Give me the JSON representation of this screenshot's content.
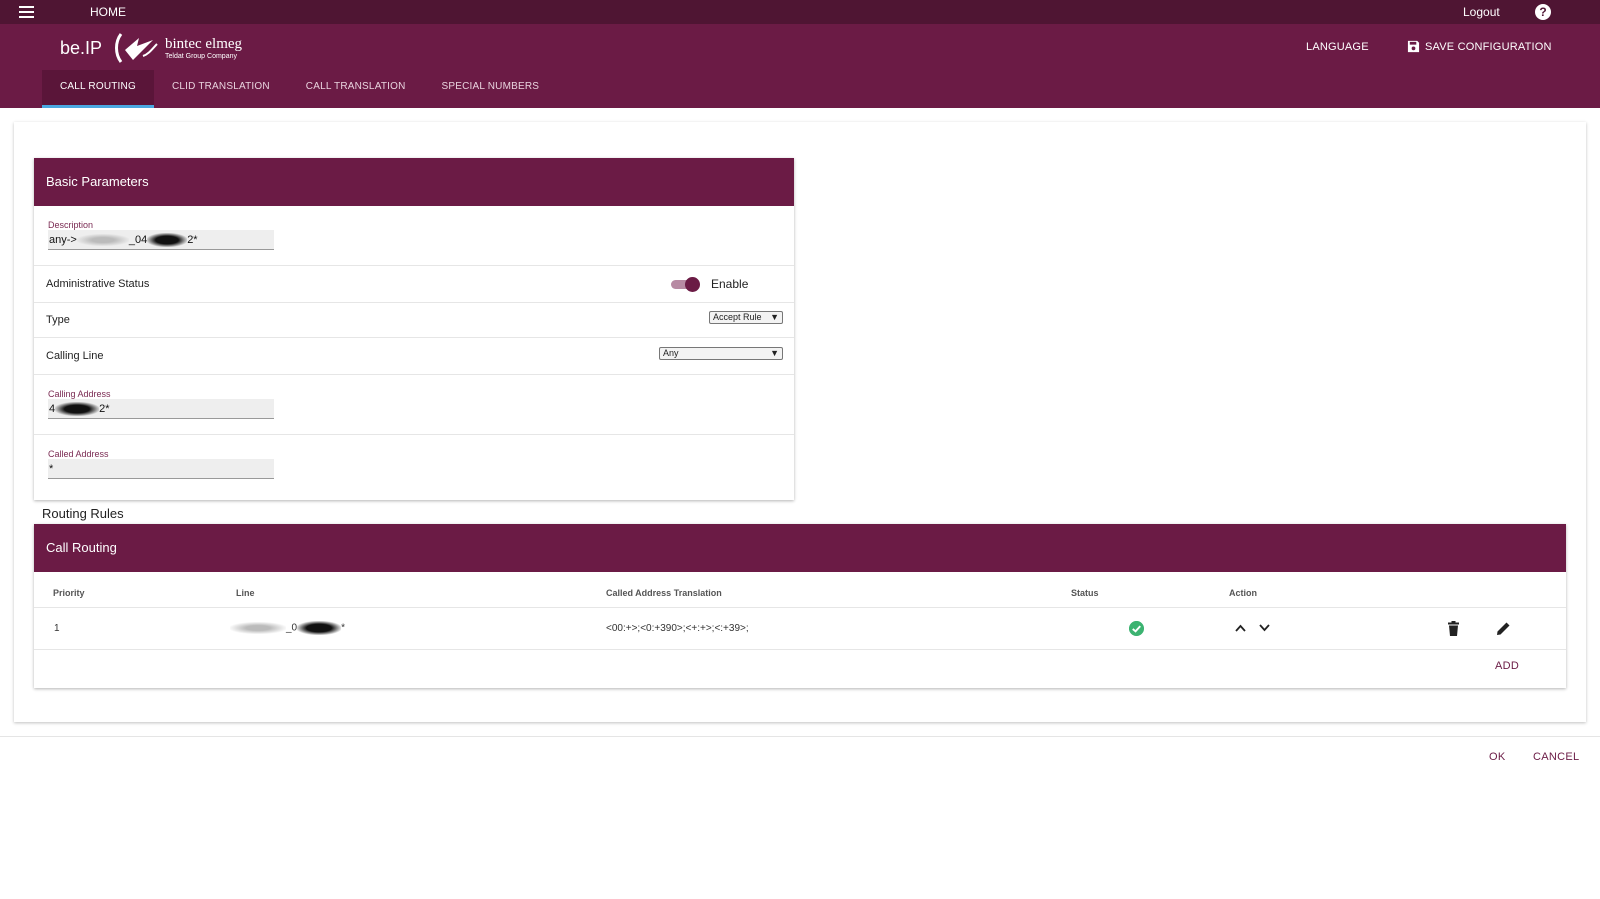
{
  "topbar": {
    "home_label": "HOME",
    "logout_label": "Logout",
    "help_glyph": "?"
  },
  "header": {
    "app_title": "be.IP",
    "brand_name": "bintec elmeg",
    "brand_tagline": "Teldat Group Company",
    "language_label": "LANGUAGE",
    "save_label": "SAVE CONFIGURATION"
  },
  "tabs": [
    {
      "label": "CALL ROUTING",
      "active": true
    },
    {
      "label": "CLID TRANSLATION",
      "active": false
    },
    {
      "label": "CALL TRANSLATION",
      "active": false
    },
    {
      "label": "SPECIAL NUMBERS",
      "active": false
    }
  ],
  "basic": {
    "title": "Basic Parameters",
    "description": {
      "label": "Description",
      "value_prefix": "any->",
      "value_mid": "_04",
      "value_suffix": "2*"
    },
    "admin_status": {
      "label": "Administrative Status",
      "toggle_label": "Enable",
      "enabled": true
    },
    "type": {
      "label": "Type",
      "selected": "Accept Rule"
    },
    "calling_line": {
      "label": "Calling Line",
      "selected": "Any"
    },
    "calling_address": {
      "label": "Calling Address",
      "value_prefix": "4",
      "value_suffix": "2*"
    },
    "called_address": {
      "label": "Called Address",
      "value": "*"
    }
  },
  "routing_rules_title": "Routing Rules",
  "routing": {
    "title": "Call Routing",
    "columns": {
      "priority": "Priority",
      "line": "Line",
      "translation": "Called Address Translation",
      "status": "Status",
      "action": "Action"
    },
    "rows": [
      {
        "priority": "1",
        "line_mid": "_0",
        "line_suffix": "*",
        "translation": "<00:+>;<0:+390>;<+:+>;<:+39>;",
        "status": "active"
      }
    ],
    "add_label": "ADD"
  },
  "footer": {
    "ok_label": "OK",
    "cancel_label": "CANCEL"
  },
  "colors": {
    "brand": "#6b1b45",
    "topbar": "#4f1533",
    "tab_indicator": "#4aa8e0",
    "status_ok": "#3cb371"
  }
}
